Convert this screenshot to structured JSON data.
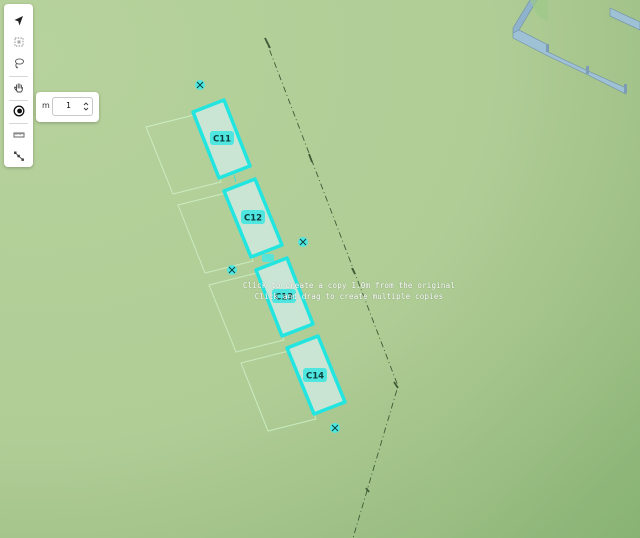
{
  "toolbar": {
    "tools": [
      {
        "name": "select-tool",
        "icon": "arrow-pointer-icon"
      },
      {
        "name": "area-select-tool",
        "icon": "marquee-select-icon"
      },
      {
        "name": "lasso-tool",
        "icon": "lasso-icon"
      },
      {
        "name": "pan-tool",
        "icon": "hand-icon"
      },
      {
        "name": "offset-copy-tool",
        "icon": "offset-target-icon",
        "active": true
      },
      {
        "name": "measure-tool",
        "icon": "ruler-icon"
      },
      {
        "name": "path-tool",
        "icon": "path-nodes-icon"
      }
    ]
  },
  "offset_panel": {
    "unit": "m",
    "value": "1"
  },
  "labels": {
    "c11": "C11",
    "c12": "C12",
    "c13": "C13",
    "c14": "C14"
  },
  "hint": {
    "line1": "Click to create a copy 1.0m from the original",
    "line2": "Click and drag to create multiple copies"
  },
  "colors": {
    "ground": "#b5d09a",
    "selection": "#22e5e0",
    "ghost": "#c8ecc0",
    "wall": "#8fb3cc"
  }
}
